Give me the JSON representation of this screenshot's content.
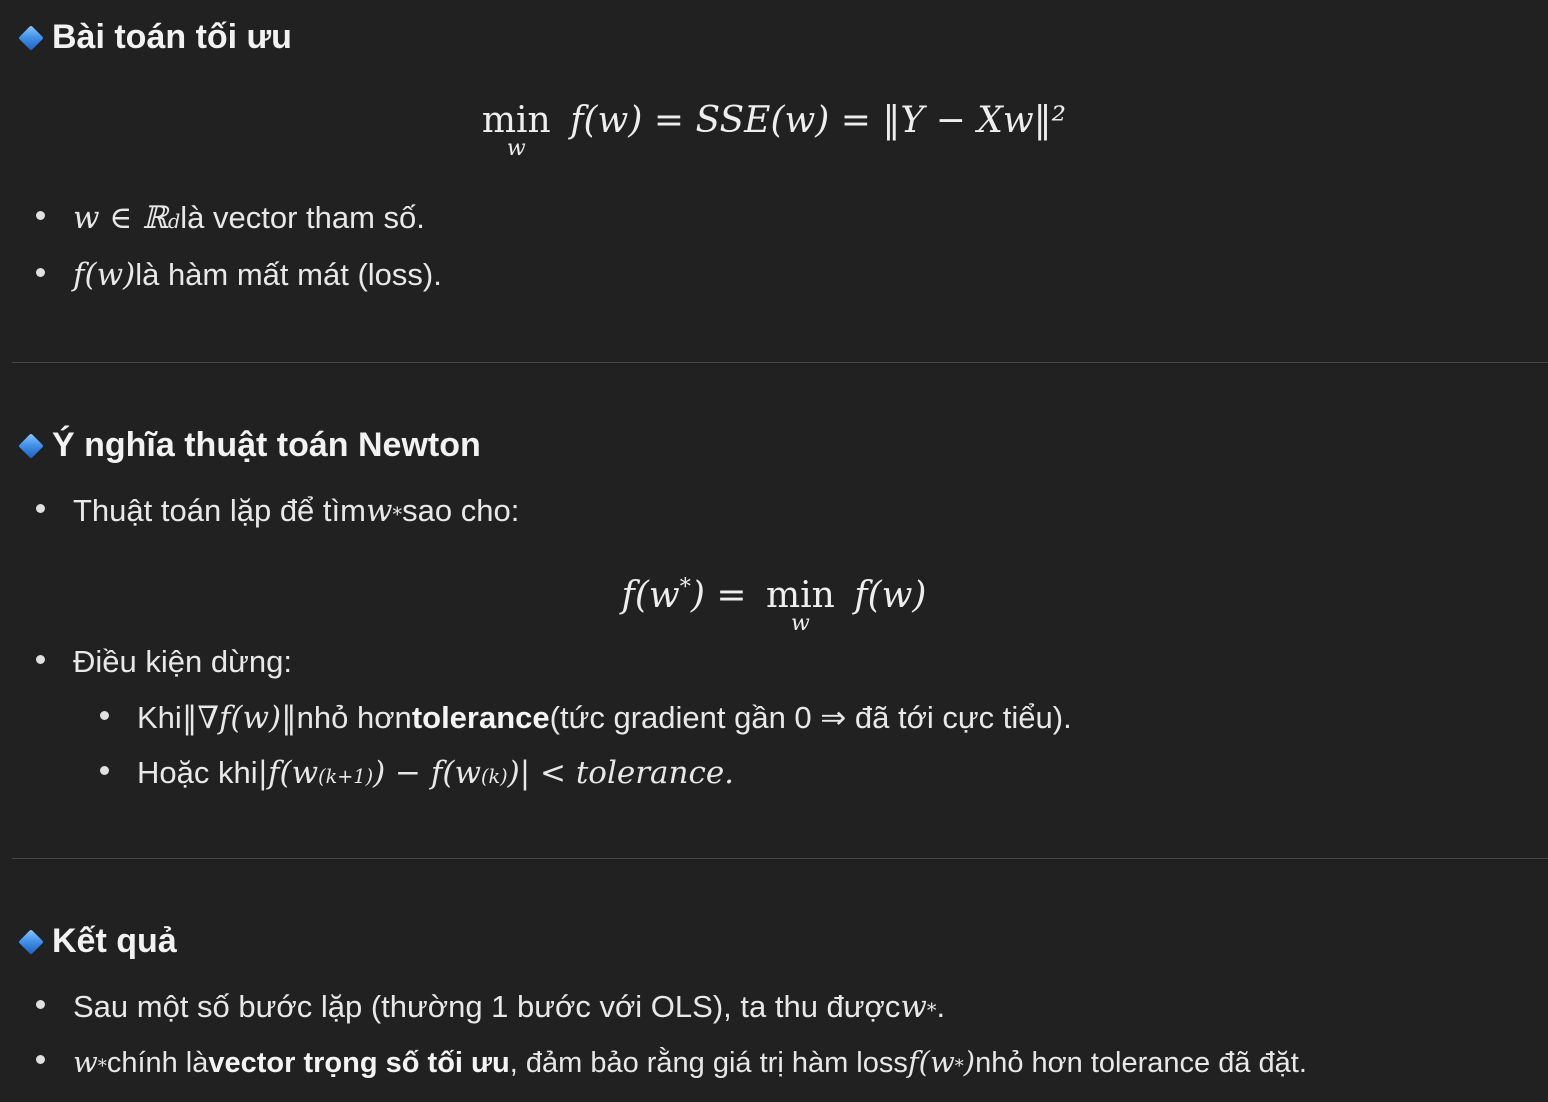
{
  "sections": [
    {
      "title": "Bài toán tối ưu",
      "formula": {
        "op": "min",
        "op_sub": "w",
        "rhs": "f(w) = SSE(w) = ‖Y − Xw‖²"
      },
      "bullets": [
        {
          "math": "w ∈ ℝ",
          "sup": "d",
          "text": " là vector tham số."
        },
        {
          "math": "f(w)",
          "text": " là hàm mất mát (loss)."
        }
      ]
    },
    {
      "title": "Ý nghĩa thuật toán Newton",
      "bullet1": {
        "text": "Thuật toán lặp để tìm ",
        "math": "w",
        "sup": "*",
        "text_after": " sao cho:"
      },
      "formula": {
        "lhs": "f(w",
        "lhs_sup": "*",
        "lhs_close": ") =",
        "op": "min",
        "op_sub": "w",
        "rhs": "f(w)"
      },
      "bullet2": {
        "text": "Điều kiện dừng:"
      },
      "sub_bullets": [
        {
          "prefix": "Khi ",
          "math": "‖∇f(w)‖",
          "mid": " nhỏ hơn ",
          "bold": "tolerance",
          "suffix": " (tức gradient gần 0 ⇒ đã tới cực tiểu)."
        },
        {
          "prefix": "Hoặc khi ",
          "math_a": "|f(w",
          "sup_a": "(k+1)",
          "math_b": ") − f(w",
          "sup_b": "(k)",
          "math_c": ")| < tolerance."
        }
      ]
    },
    {
      "title": "Kết quả",
      "bullet1": {
        "text": "Sau một số bước lặp (thường 1 bước với OLS), ta thu được ",
        "math": "w",
        "sup": "*",
        "suffix": "."
      },
      "bullet2": {
        "math": "w",
        "sup": "*",
        "text": " chính là ",
        "bold": "vector trọng số tối ưu",
        "text2": ", đảm bảo rằng giá trị hàm loss ",
        "math2": "f(w",
        "sup2": "*",
        "math2_close": ")",
        "suffix": " nhỏ hơn tolerance đã đặt."
      }
    }
  ]
}
